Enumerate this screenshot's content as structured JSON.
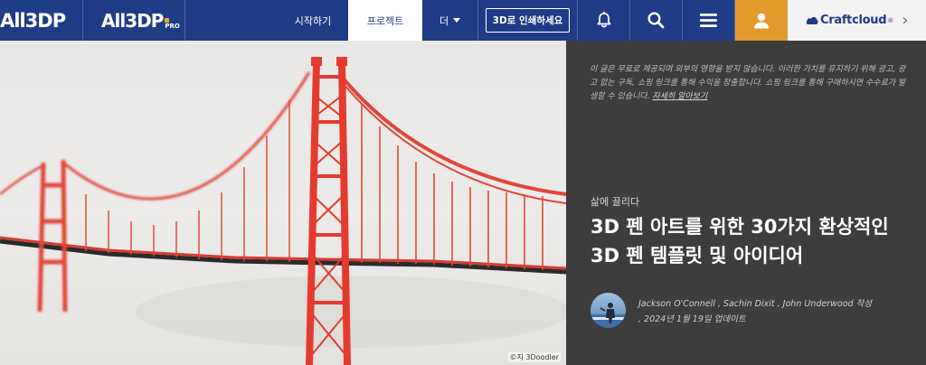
{
  "nav": {
    "logo": "All3DP",
    "logo_pro": "All3DP",
    "pro_label": "PRO",
    "menu_start": "시작하기",
    "menu_project": "프로젝트",
    "menu_more": "더",
    "print_button": "3D로 인쇄하세요",
    "icons": [
      "bell-icon",
      "search-icon",
      "hamburger-menu-icon",
      "user-icon"
    ],
    "craftcloud": "Craftcloud",
    "craftcloud_reg": "®",
    "craftcloud_chevron": "›",
    "accent_color": "#1f3d86",
    "user_color": "#e39a2c"
  },
  "hero": {
    "credit": "©지 3Doodler"
  },
  "article": {
    "disclaimer": "이 글은 무료로 제공되며 외부의 영향을 받지 않습니다. 이러한 가치를 유지하기 위해 광고, 광고 없는 구독, 쇼핑 링크를 통해 수익을 창출합니다. 쇼핑 링크를 통해 구매하시면 수수료가 발생할 수 있습니다.",
    "learn_more": "자세히 알아보기",
    "category": "삶에 끌리다",
    "title": "3D 펜 아트를 위한 30가지 환상적인 3D 펜 템플릿 및 아이디어",
    "authors": "Jackson O'Connell , Sachin Dixit , John Underwood 작성",
    "updated": ", 2024년 1월 19일 업데이트"
  }
}
